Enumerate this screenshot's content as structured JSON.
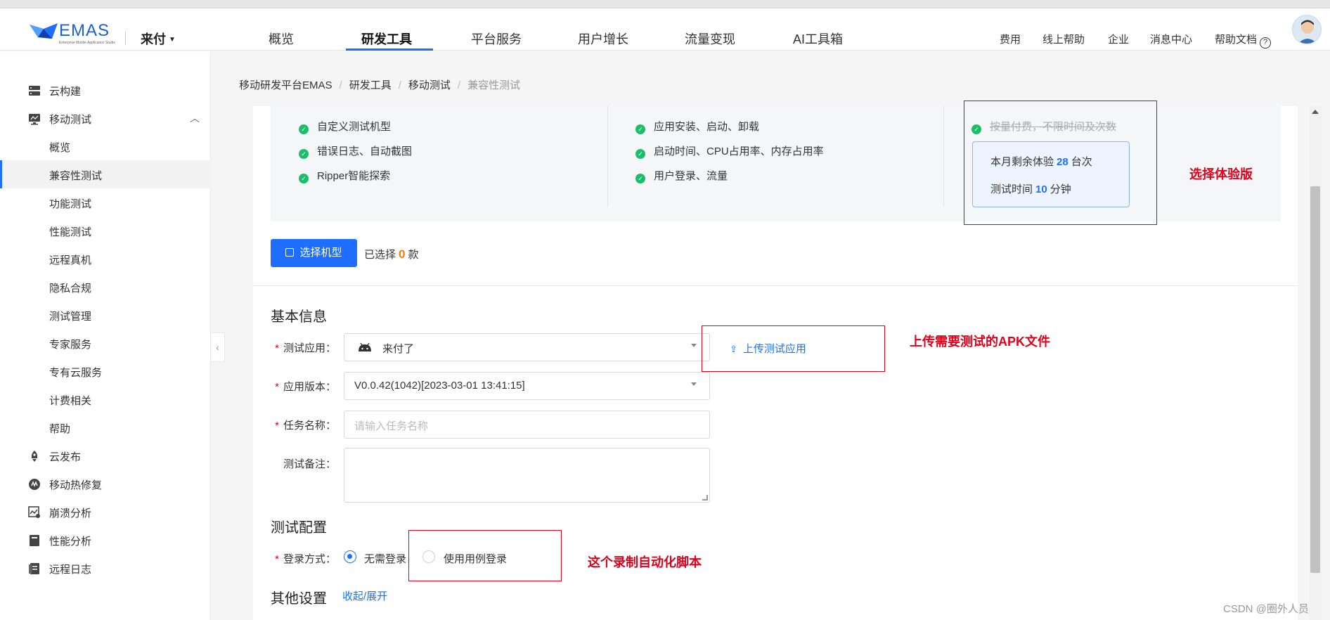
{
  "header": {
    "logo_text": "EMAS",
    "logo_subtitle": "Enterprise Mobile Application Studio",
    "app_name": "来付",
    "tabs": [
      "概览",
      "研发工具",
      "平台服务",
      "用户增长",
      "流量变现",
      "AI工具箱"
    ],
    "active_tab": "研发工具",
    "right_links": [
      "费用",
      "线上帮助",
      "企业",
      "消息中心",
      "帮助文档"
    ]
  },
  "sidebar": {
    "items": [
      {
        "label": "云构建",
        "icon": "server-icon"
      },
      {
        "label": "移动测试",
        "icon": "monitor-icon",
        "expanded": true
      },
      {
        "label": "概览"
      },
      {
        "label": "兼容性测试",
        "active": true
      },
      {
        "label": "功能测试"
      },
      {
        "label": "性能测试"
      },
      {
        "label": "远程真机"
      },
      {
        "label": "隐私合规"
      },
      {
        "label": "测试管理"
      },
      {
        "label": "专家服务"
      },
      {
        "label": "专有云服务"
      },
      {
        "label": "计费相关"
      },
      {
        "label": "帮助"
      },
      {
        "label": "云发布",
        "icon": "rocket-icon"
      },
      {
        "label": "移动热修复",
        "icon": "hotfix-icon"
      },
      {
        "label": "崩溃分析",
        "icon": "crash-chart-icon"
      },
      {
        "label": "性能分析",
        "icon": "performance-icon"
      },
      {
        "label": "远程日志",
        "icon": "log-icon"
      }
    ]
  },
  "breadcrumb": [
    "移动研发平台EMAS",
    "研发工具",
    "移动测试",
    "兼容性测试"
  ],
  "features": {
    "col1": [
      "自定义测试机型",
      "错误日志、自动截图",
      "Ripper智能探索"
    ],
    "col2": [
      "应用安装、启动、卸载",
      "启动时间、CPU占用率、内存占用率",
      "用户登录、流量"
    ],
    "col3_strikethrough": "按量付费，不限时间及次数"
  },
  "trial": {
    "remaining_prefix": "本月剩余体验",
    "remaining_value": "28",
    "remaining_unit": "台次",
    "time_prefix": "测试时间",
    "time_value": "10",
    "time_unit": "分钟"
  },
  "device_select": {
    "button_label": "选择机型",
    "selected_prefix": "已选择",
    "selected_count": "0",
    "selected_unit": "款"
  },
  "basic_info": {
    "title": "基本信息",
    "test_app_label": "测试应用：",
    "test_app_value": "来付了",
    "app_version_label": "应用版本：",
    "app_version_value": "V0.0.42(1042)[2023-03-01 13:41:15]",
    "task_name_label": "任务名称：",
    "task_name_placeholder": "请输入任务名称",
    "remark_label": "测试备注：",
    "upload_label": "上传测试应用"
  },
  "test_config": {
    "title": "测试配置",
    "login_label": "登录方式：",
    "option_no_login": "无需登录",
    "option_case_login": "使用用例登录",
    "selected": "无需登录"
  },
  "other_settings": {
    "title": "其他设置",
    "toggle_label": "收起/展开"
  },
  "annotations": {
    "trial_note": "选择体验版",
    "upload_note": "上传需要测试的APK文件",
    "script_note": "这个录制自动化脚本"
  },
  "watermark": "CSDN @圈外人员",
  "colors": {
    "accent": "#1e6fff",
    "annotation_red": "#e0001a",
    "count_orange": "#ff7a00",
    "check_green": "#1bbf6a"
  }
}
